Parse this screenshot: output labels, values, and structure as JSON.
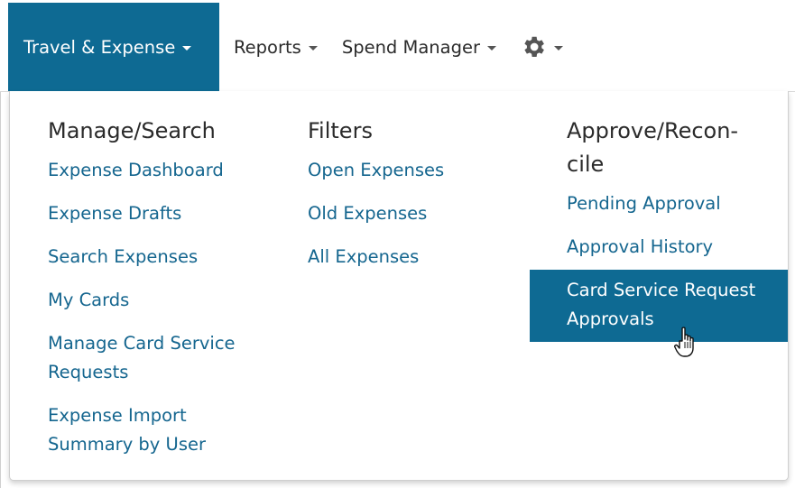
{
  "nav": {
    "items": [
      {
        "label": "Travel & Expense"
      },
      {
        "label": "Reports"
      },
      {
        "label": "Spend Manager"
      }
    ],
    "settings_icon": "gear-icon"
  },
  "menu": {
    "columns": [
      {
        "title": "Manage/Search",
        "links": [
          "Expense Dashboard",
          "Expense Drafts",
          "Search Expenses",
          "My Cards",
          "Manage Card Service Requests",
          "Expense Import Summary by User"
        ]
      },
      {
        "title": "Filters",
        "links": [
          "Open Expenses",
          "Old Expenses",
          "All Expenses"
        ]
      },
      {
        "title": "Approve/Recon­cile",
        "links": [
          "Pending Approval",
          "Approval History",
          "Card Service Request Approvals"
        ]
      }
    ]
  },
  "colors": {
    "active_bg": "#0e6a93",
    "link": "#15668f",
    "heading": "#2b2b2b"
  }
}
